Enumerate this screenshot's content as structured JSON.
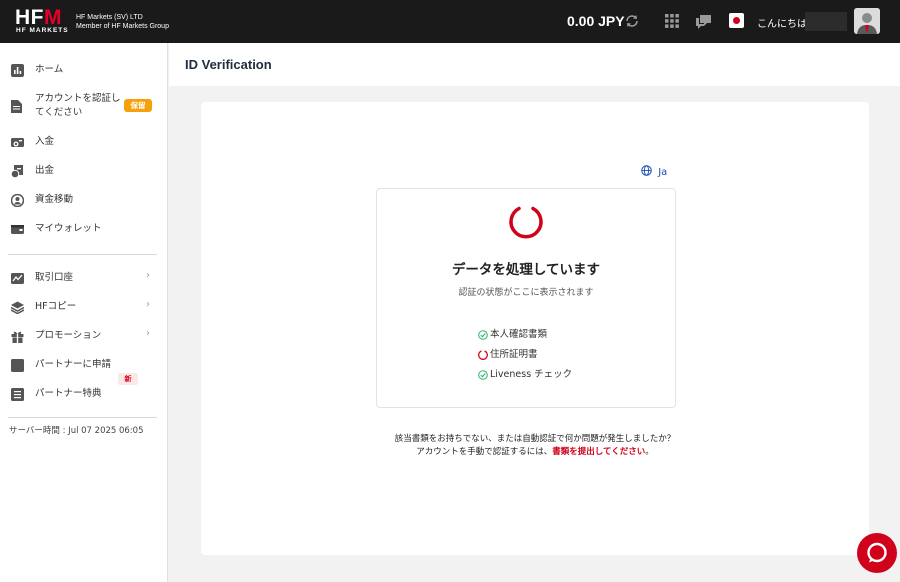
{
  "header": {
    "logo": {
      "main_a": "HF",
      "main_b": "M",
      "sub": "HF MARKETS"
    },
    "company_line1": "HF Markets (SV) LTD",
    "company_line2": "Member of HF Markets Group",
    "balance": "0.00 JPY",
    "greeting": "こんにちは",
    "icons": [
      "refresh-icon",
      "apps-grid-icon",
      "chat-bubbles-icon",
      "japan-flag-icon",
      "avatar"
    ]
  },
  "sidebar": {
    "items": [
      {
        "label": "ホーム",
        "icon": "chart-icon"
      },
      {
        "label": "アカウントを認証し",
        "label2": "てください",
        "icon": "document-icon",
        "badge": "保留"
      },
      {
        "label": "入金",
        "icon": "deposit-icon"
      },
      {
        "label": "出金",
        "icon": "withdraw-icon"
      },
      {
        "label": "資金移動",
        "icon": "transfer-icon"
      },
      {
        "label": "マイウォレット",
        "icon": "wallet-icon"
      },
      {
        "label": "取引口座",
        "icon": "trading-chart-icon"
      },
      {
        "label": "HFコピー",
        "icon": "layers-icon"
      },
      {
        "label": "プロモーション",
        "icon": "gift-icon",
        "badge": "新"
      },
      {
        "label": "パートナーに申請",
        "icon": "partner-icon"
      },
      {
        "label": "パートナー特典",
        "icon": "list-icon"
      }
    ],
    "server_time": "サーバー時間 : Jul 07 2025 06:05"
  },
  "main": {
    "page_title": "ID Verification",
    "language": "Ja",
    "processing_title": "データを処理しています",
    "processing_subtitle": "認証の状態がここに表示されます",
    "checks": [
      {
        "label": "本人確認書類",
        "status": "done"
      },
      {
        "label": "住所証明書",
        "status": "pending"
      },
      {
        "label": "Liveness チェック",
        "status": "done"
      }
    ],
    "help_line1": "該当書類をお持ちでない、または自動認証で何か問題が発生しましたか？",
    "help_line2_prefix": "アカウントを手動で認証するには、",
    "help_link": "書類を提出してください",
    "help_line2_suffix": "。"
  },
  "colors": {
    "accent_red": "#d0021b",
    "badge_orange": "#f5a10a",
    "check_green": "#2bb673",
    "link_blue": "#1a4fb5"
  }
}
